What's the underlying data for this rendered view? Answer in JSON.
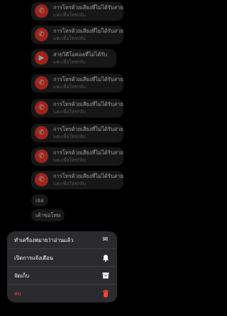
{
  "messages": [
    {
      "type": "call",
      "title": "การโทรด้วยเสียงที่ไม่ได้รับสาย",
      "sub": "แตะเพื่อโทรกลับ",
      "icon": "phone-missed-icon"
    },
    {
      "type": "call",
      "title": "การโทรด้วยเสียงที่ไม่ได้รับสาย",
      "sub": "แตะเพื่อโทรกลับ",
      "icon": "phone-missed-icon"
    },
    {
      "type": "call",
      "title": "สายวิดีโอคอลที่ไม่ได้รับ",
      "sub": "แตะเพื่อโทรกลับ",
      "icon": "video-missed-icon"
    },
    {
      "type": "call",
      "title": "การโทรด้วยเสียงที่ไม่ได้รับสาย",
      "sub": "แตะเพื่อโทรกลับ",
      "icon": "phone-missed-icon"
    },
    {
      "type": "call",
      "title": "การโทรด้วยเสียงที่ไม่ได้รับสาย",
      "sub": "แตะเพื่อโทรกลับ",
      "icon": "phone-missed-icon"
    },
    {
      "type": "call",
      "title": "การโทรด้วยเสียงที่ไม่ได้รับสาย",
      "sub": "แตะเพื่อโทรกลับ",
      "icon": "phone-missed-icon"
    },
    {
      "type": "call",
      "title": "การโทรด้วยเสียงที่ไม่ได้รับสาย",
      "sub": "แตะเพื่อโทรกลับ",
      "icon": "phone-missed-icon"
    },
    {
      "type": "call",
      "title": "การโทรด้วยเสียงที่ไม่ได้รับสาย",
      "sub": "แตะเพื่อโทรกลับ",
      "icon": "phone-missed-icon"
    },
    {
      "type": "text",
      "text": "เธอ"
    },
    {
      "type": "text",
      "text": "เค้าขอโทษ"
    }
  ],
  "menu": {
    "items": [
      {
        "label": "ทำเครื่องหมายว่าอ่านแล้ว",
        "icon": "envelope-open-icon"
      },
      {
        "label": "เปิดการแจ้งเตือน",
        "icon": "bell-icon"
      },
      {
        "label": "จัดเก็บ",
        "icon": "archive-box-icon"
      },
      {
        "label": "ลบ",
        "icon": "trash-icon",
        "danger": true
      }
    ]
  },
  "colors": {
    "background": "#000000",
    "bubble": "#262628",
    "missed_call_red": "#ff3b30",
    "menu_bg": "#2b2b2e",
    "danger": "#ff453a"
  }
}
